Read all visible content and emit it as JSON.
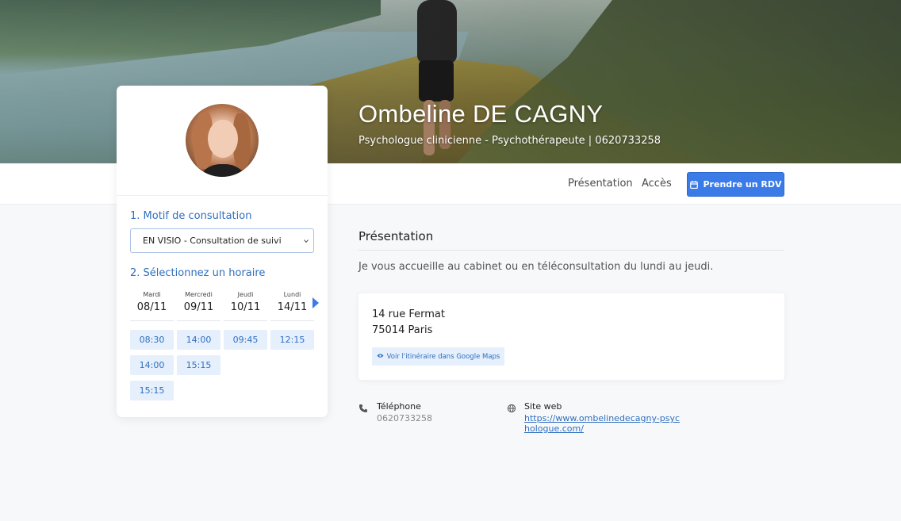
{
  "hero": {
    "name": "Ombeline DE CAGNY",
    "subtitle": "Psychologue clinicienne - Psychothérapeute | 0620733258"
  },
  "nav": {
    "presentation": "Présentation",
    "acces": "Accès",
    "rdv_button": "Prendre un RDV"
  },
  "booking": {
    "motif_label": "1. Motif de consultation",
    "motif_selected": "EN VISIO - Consultation de suivi",
    "horaire_label": "2. Sélectionnez un horaire",
    "days": [
      {
        "name": "Mardi",
        "date": "08/11",
        "slots": [
          "08:30",
          "14:00",
          "15:15"
        ]
      },
      {
        "name": "Mercredi",
        "date": "09/11",
        "slots": [
          "14:00",
          "15:15"
        ]
      },
      {
        "name": "Jeudi",
        "date": "10/11",
        "slots": [
          "09:45"
        ]
      },
      {
        "name": "Lundi",
        "date": "14/11",
        "slots": [
          "12:15"
        ]
      }
    ]
  },
  "presentation": {
    "title": "Présentation",
    "text": "Je vous accueille au cabinet ou en téléconsultation du lundi au jeudi."
  },
  "address": {
    "line1": "14 rue Fermat",
    "line2": "75014 Paris",
    "maps_button": "Voir l'itinéraire dans Google Maps"
  },
  "contact": {
    "phone_label": "Téléphone",
    "phone_value": "0620733258",
    "website_label": "Site web",
    "website_value": "https://www.ombelinedecagny-psychologue.com/"
  },
  "colors": {
    "accent": "#3b7be8",
    "link": "#2f6fbf",
    "slot_bg": "#e6effc"
  }
}
